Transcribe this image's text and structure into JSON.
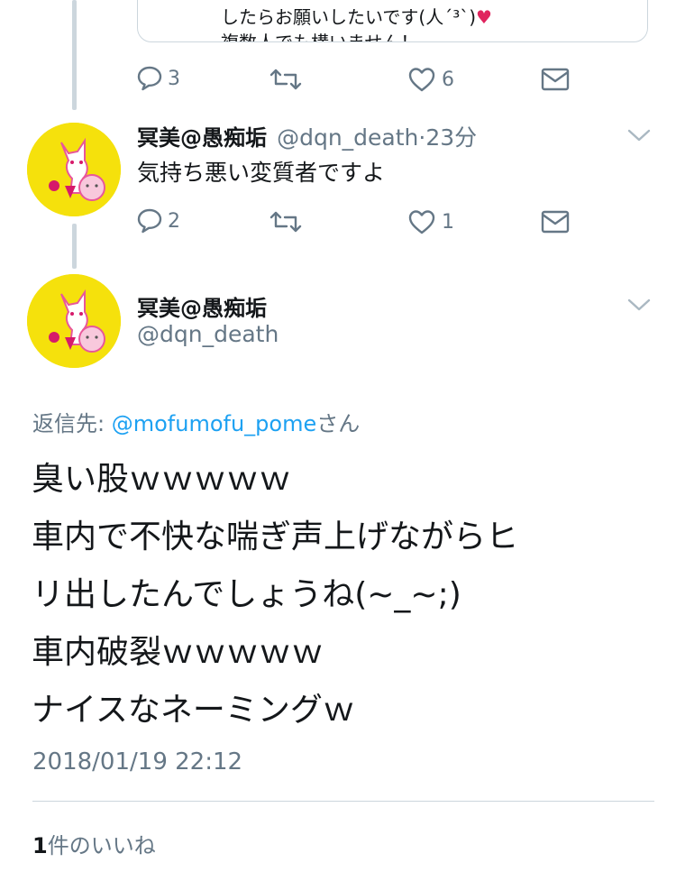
{
  "colors": {
    "link": "#1da1f2",
    "secondary": "#657786",
    "primary": "#14171a",
    "heart": "#e0245e",
    "avatar_bg": "#f5e10c"
  },
  "quoted": {
    "line1": "したらお願いしたいです(人ˊ³ˋ)",
    "line2": "複数人でも構いません！"
  },
  "tweet1_actions": {
    "reply": "3",
    "retweet": "",
    "like": "6"
  },
  "tweet2": {
    "name": "冥美@愚痴垢",
    "handle": "@dqn_death",
    "dot": "·",
    "time": "23分",
    "text": "気持ち悪い変質者ですよ",
    "actions": {
      "reply": "2",
      "retweet": "",
      "like": "1"
    }
  },
  "main": {
    "name": "冥美@愚痴垢",
    "handle": "@dqn_death",
    "reply_prefix": "返信先: ",
    "reply_to": "@mofumofu_pome",
    "reply_suffix": "さん",
    "lines": [
      "臭い股ｗｗｗｗｗ",
      "車内で不快な喘ぎ声上げながらヒ",
      "リ出したんでしょうね(~_~;)",
      "車内破裂ｗｗｗｗｗ",
      "ナイスなネーミングｗ"
    ],
    "timestamp": "2018/01/19 22:12",
    "likes_count": "1",
    "likes_label": "件のいいね"
  }
}
